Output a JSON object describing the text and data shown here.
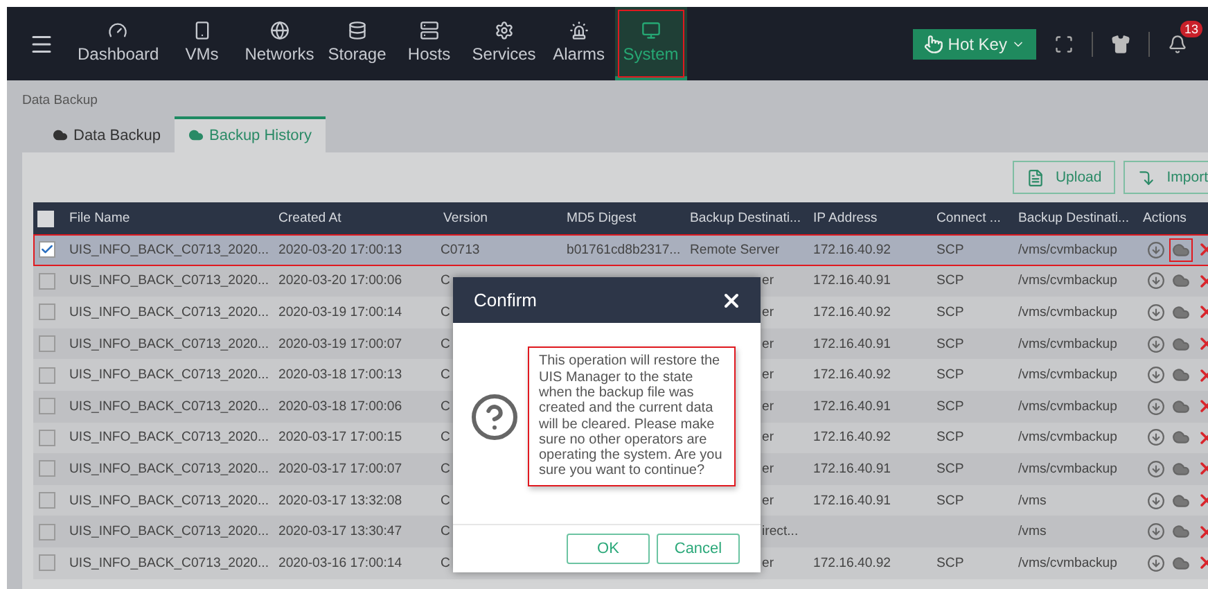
{
  "top_bar": {
    "nav_items": [
      {
        "label": "Dashboard",
        "selected": false,
        "annotated": false
      },
      {
        "label": "VMs",
        "selected": false,
        "annotated": false
      },
      {
        "label": "Networks",
        "selected": false,
        "annotated": false
      },
      {
        "label": "Storage",
        "selected": false,
        "annotated": false
      },
      {
        "label": "Hosts",
        "selected": false,
        "annotated": false
      },
      {
        "label": "Services",
        "selected": false,
        "annotated": false
      },
      {
        "label": "Alarms",
        "selected": false,
        "annotated": false
      },
      {
        "label": "System",
        "selected": true,
        "annotated": true
      }
    ],
    "hot_key": "Hot Key",
    "notification_count": "13"
  },
  "breadcrumb": "Data Backup",
  "tabs": [
    {
      "label": "Data Backup",
      "selected": false
    },
    {
      "label": "Backup History",
      "selected": true
    }
  ],
  "toolbar": {
    "buttons": [
      "Upload",
      "Import"
    ]
  },
  "table": {
    "select_all": false,
    "columns": [
      "File Name",
      "Created At",
      "Version",
      "MD5 Digest",
      "Backup Destinati...",
      "IP Address",
      "Connect ...",
      "Backup Destinati...",
      "Actions"
    ],
    "rows": [
      {
        "kind": "full",
        "selected": true,
        "annotated": true,
        "restore_annotated": true,
        "file_name": "UIS_INFO_BACK_C0713_2020...",
        "created_at": "2020-03-20 17:00:13",
        "version": "C0713",
        "md5": "b01761cd8b2317...",
        "destination": "Remote Server",
        "ip": "172.16.40.92",
        "protocol": "SCP",
        "path": "/vms/cvmbackup"
      },
      {
        "kind": "covered",
        "selected": false,
        "annotated": false,
        "restore_annotated": false,
        "file_name": "UIS_INFO_BACK_C0713_2020...",
        "created_at": "2020-03-20 17:00:06",
        "version": "C",
        "destination": "er",
        "ip": "172.16.40.91",
        "protocol": "SCP",
        "path": "/vms/cvmbackup"
      },
      {
        "kind": "covered",
        "selected": false,
        "annotated": false,
        "restore_annotated": false,
        "file_name": "UIS_INFO_BACK_C0713_2020...",
        "created_at": "2020-03-19 17:00:14",
        "version": "C",
        "destination": "er",
        "ip": "172.16.40.92",
        "protocol": "SCP",
        "path": "/vms/cvmbackup"
      },
      {
        "kind": "covered",
        "selected": false,
        "annotated": false,
        "restore_annotated": false,
        "file_name": "UIS_INFO_BACK_C0713_2020...",
        "created_at": "2020-03-19 17:00:07",
        "version": "C",
        "destination": "er",
        "ip": "172.16.40.91",
        "protocol": "SCP",
        "path": "/vms/cvmbackup"
      },
      {
        "kind": "covered",
        "selected": false,
        "annotated": false,
        "restore_annotated": false,
        "file_name": "UIS_INFO_BACK_C0713_2020...",
        "created_at": "2020-03-18 17:00:13",
        "version": "C",
        "destination": "er",
        "ip": "172.16.40.92",
        "protocol": "SCP",
        "path": "/vms/cvmbackup"
      },
      {
        "kind": "covered",
        "selected": false,
        "annotated": false,
        "restore_annotated": false,
        "file_name": "UIS_INFO_BACK_C0713_2020...",
        "created_at": "2020-03-18 17:00:06",
        "version": "C",
        "destination": "er",
        "ip": "172.16.40.91",
        "protocol": "SCP",
        "path": "/vms/cvmbackup"
      },
      {
        "kind": "covered",
        "selected": false,
        "annotated": false,
        "restore_annotated": false,
        "file_name": "UIS_INFO_BACK_C0713_2020...",
        "created_at": "2020-03-17 17:00:15",
        "version": "C",
        "destination": "er",
        "ip": "172.16.40.92",
        "protocol": "SCP",
        "path": "/vms/cvmbackup"
      },
      {
        "kind": "covered",
        "selected": false,
        "annotated": false,
        "restore_annotated": false,
        "file_name": "UIS_INFO_BACK_C0713_2020...",
        "created_at": "2020-03-17 17:00:07",
        "version": "C",
        "destination": "er",
        "ip": "172.16.40.91",
        "protocol": "SCP",
        "path": "/vms/cvmbackup"
      },
      {
        "kind": "covered",
        "selected": false,
        "annotated": false,
        "restore_annotated": false,
        "file_name": "UIS_INFO_BACK_C0713_2020...",
        "created_at": "2020-03-17 13:32:08",
        "version": "C",
        "destination": "er",
        "ip": "172.16.40.91",
        "protocol": "SCP",
        "path": "/vms"
      },
      {
        "kind": "covered",
        "selected": false,
        "annotated": false,
        "restore_annotated": false,
        "file_name": "UIS_INFO_BACK_C0713_2020...",
        "created_at": "2020-03-17 13:30:47",
        "version": "C",
        "destination": "irect...",
        "path": "/vms"
      },
      {
        "kind": "covered",
        "selected": false,
        "annotated": false,
        "restore_annotated": false,
        "file_name": "UIS_INFO_BACK_C0713_2020...",
        "created_at": "2020-03-16 17:00:14",
        "version": "C",
        "destination": "er",
        "ip": "172.16.40.92",
        "protocol": "SCP",
        "path": "/vms/cvmbackup"
      }
    ]
  },
  "dialog": {
    "title": "Confirm",
    "message": "This operation will restore the UIS Manager to the state when the backup file was created and the current data will be cleared. Please make sure no other operators are operating the system. Are you sure you want to continue?",
    "message_annotated": true,
    "buttons": [
      "OK",
      "Cancel"
    ]
  }
}
